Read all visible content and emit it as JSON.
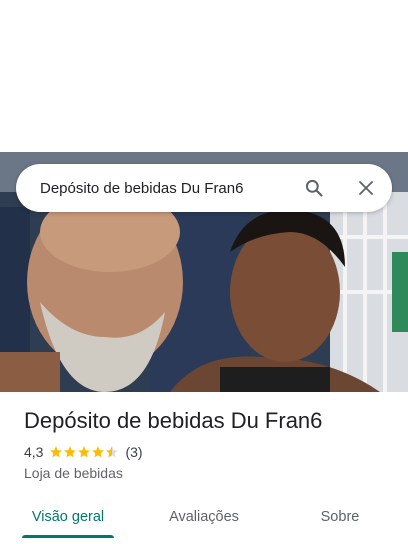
{
  "search": {
    "query": "Depósito de bebidas Du Fran6"
  },
  "place": {
    "name": "Depósito de bebidas Du Fran6",
    "rating": "4,3",
    "stars": 4.3,
    "review_count": "(3)",
    "category": "Loja de bebidas"
  },
  "tabs": [
    {
      "label": "Visão geral",
      "active": true
    },
    {
      "label": "Avaliações",
      "active": false
    },
    {
      "label": "Sobre",
      "active": false
    }
  ],
  "colors": {
    "accent": "#00796b",
    "star": "#fbbc04"
  },
  "icons": {
    "search": "search-icon",
    "close": "close-icon"
  }
}
